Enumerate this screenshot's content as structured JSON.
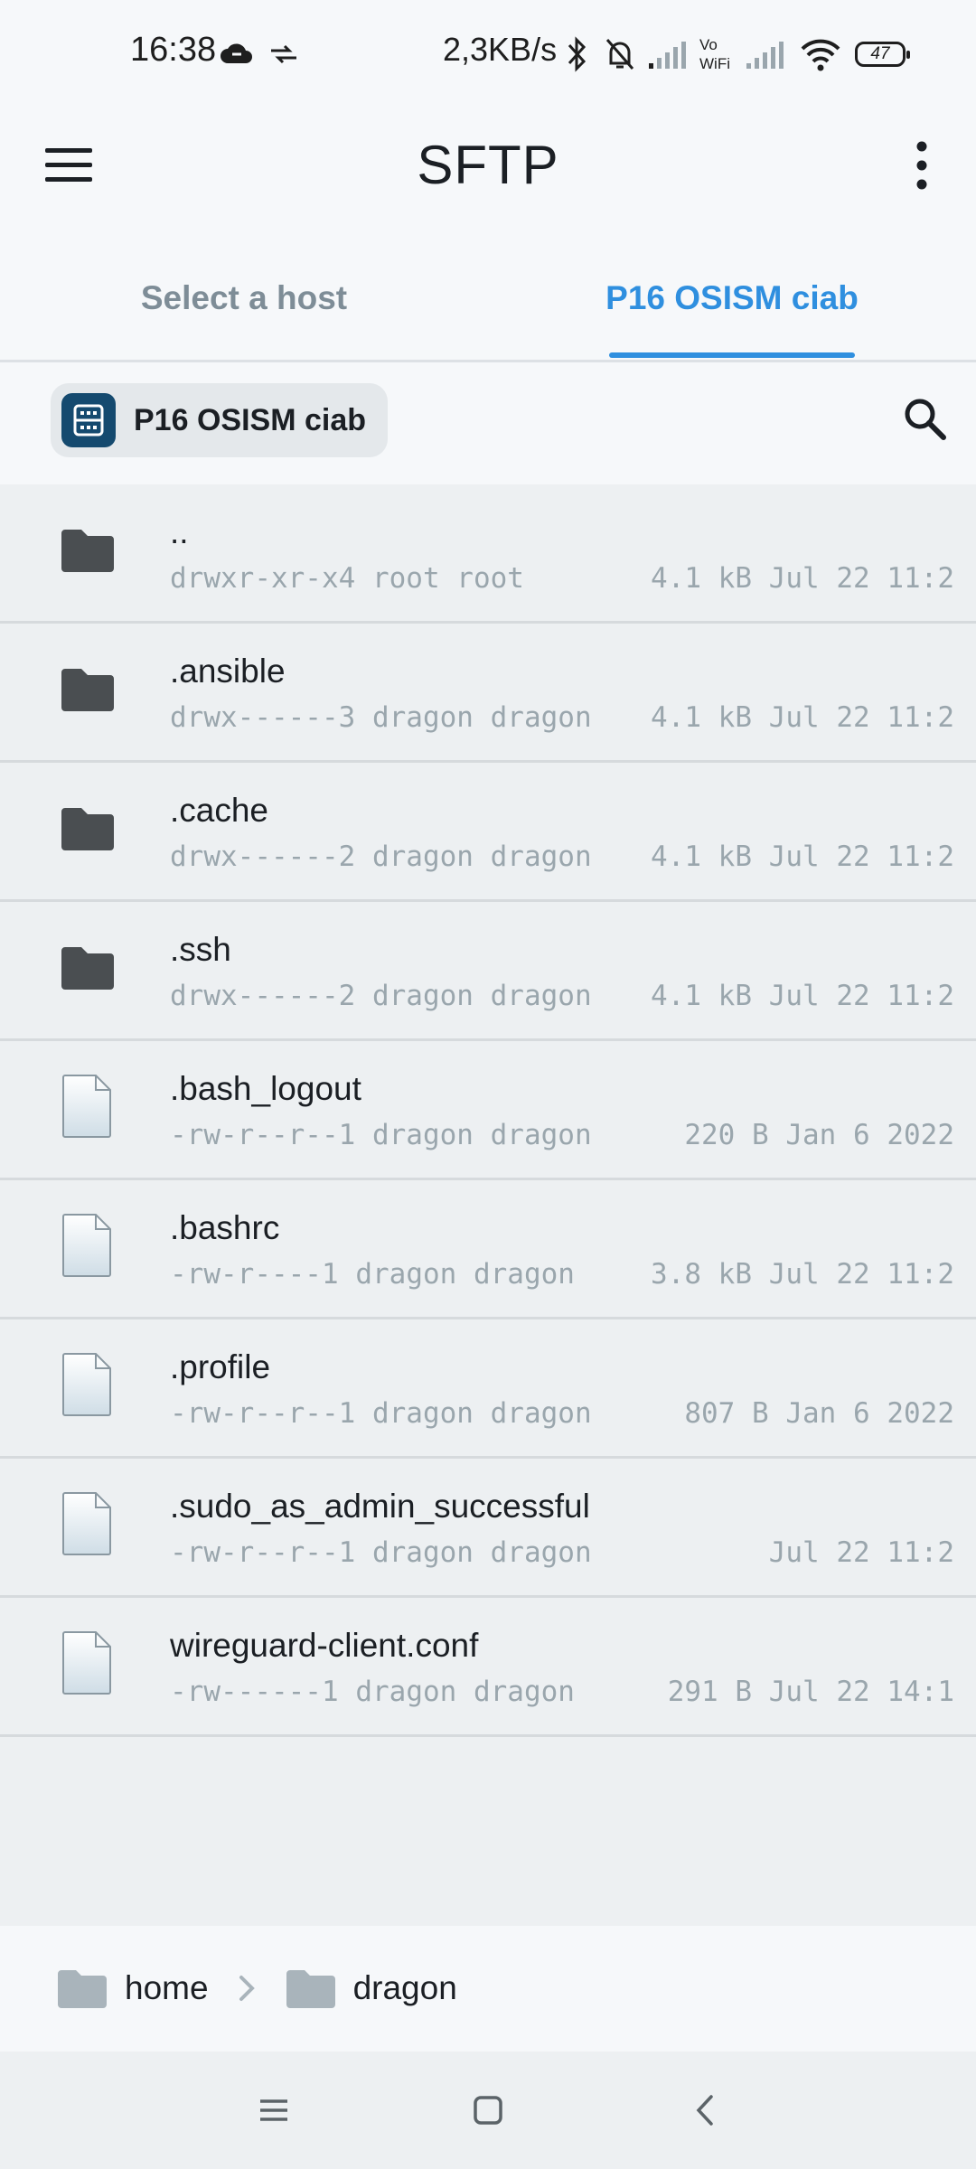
{
  "status_bar": {
    "time": "16:38",
    "net_speed": "2,3KB/s",
    "battery": "47",
    "vowifi_label": "Vo\nWiFi"
  },
  "app_bar": {
    "title": "SFTP"
  },
  "tabs": [
    {
      "label": "Select a host",
      "active": false
    },
    {
      "label": "P16 OSISM ciab",
      "active": true
    }
  ],
  "host_chip": {
    "label": "P16 OSISM ciab"
  },
  "files": [
    {
      "name": "..",
      "type": "folder",
      "meta": "drwxr-xr-x",
      "links": "4",
      "owner": "root root",
      "size": "4.1 kB",
      "date": "Jul 22 11:2"
    },
    {
      "name": ".ansible",
      "type": "folder",
      "meta": "drwx------",
      "links": "3",
      "owner": "dragon dragon",
      "size": "4.1 kB",
      "date": "Jul 22 11:2"
    },
    {
      "name": ".cache",
      "type": "folder",
      "meta": "drwx------",
      "links": "2",
      "owner": "dragon dragon",
      "size": "4.1 kB",
      "date": "Jul 22 11:2"
    },
    {
      "name": ".ssh",
      "type": "folder",
      "meta": "drwx------",
      "links": "2",
      "owner": "dragon dragon",
      "size": "4.1 kB",
      "date": "Jul 22 11:2"
    },
    {
      "name": ".bash_logout",
      "type": "file",
      "meta": "-rw-r--r--",
      "links": "1",
      "owner": "dragon dragon",
      "size": "220 B",
      "date": "Jan 6 2022"
    },
    {
      "name": ".bashrc",
      "type": "file",
      "meta": "-rw-r----",
      "links": "1",
      "owner": "dragon dragon",
      "size": "3.8 kB",
      "date": "Jul 22 11:2"
    },
    {
      "name": ".profile",
      "type": "file",
      "meta": "-rw-r--r--",
      "links": "1",
      "owner": "dragon dragon",
      "size": "807 B",
      "date": "Jan 6 2022"
    },
    {
      "name": ".sudo_as_admin_successful",
      "type": "file",
      "meta": "-rw-r--r--",
      "links": "1",
      "owner": "dragon dragon",
      "size": "",
      "date": "Jul 22 11:2"
    },
    {
      "name": "wireguard-client.conf",
      "type": "file",
      "meta": "-rw------",
      "links": "1",
      "owner": "dragon dragon",
      "size": "291 B",
      "date": "Jul 22 14:1"
    }
  ],
  "breadcrumb": [
    {
      "label": "home"
    },
    {
      "label": "dragon"
    }
  ],
  "colors": {
    "accent": "#2f8fdf",
    "host_icon_bg": "#154a6f",
    "folder_icon": "#4a4e51",
    "breadcrumb_folder": "#a9b4bb"
  }
}
